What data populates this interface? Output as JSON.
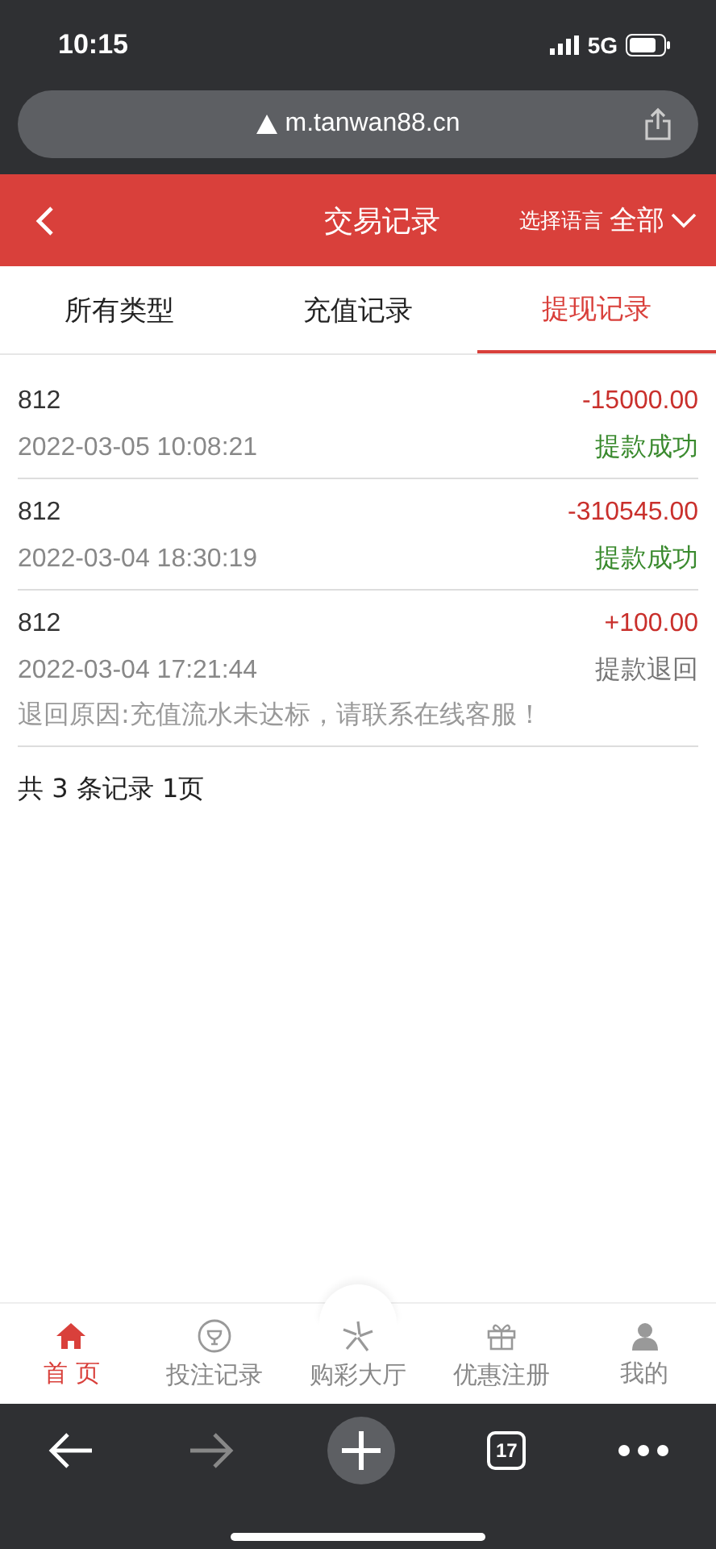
{
  "status_bar": {
    "time": "10:15",
    "network": "5G"
  },
  "browser": {
    "url": "m.tanwan88.cn",
    "tab_count": "17"
  },
  "header": {
    "title": "交易记录",
    "language": "选择语言",
    "filter": "全部"
  },
  "tabs": [
    {
      "label": "所有类型",
      "selected": false
    },
    {
      "label": "充值记录",
      "selected": false
    },
    {
      "label": "提现记录",
      "selected": true
    }
  ],
  "records": [
    {
      "name": "812",
      "amount": "-15000.00",
      "time": "2022-03-05 10:08:21",
      "status": "提款成功",
      "kind": "success"
    },
    {
      "name": "812",
      "amount": "-310545.00",
      "time": "2022-03-04 18:30:19",
      "status": "提款成功",
      "kind": "success"
    },
    {
      "name": "812",
      "amount": "+100.00",
      "time": "2022-03-04 17:21:44",
      "status": "提款退回",
      "kind": "returned",
      "note": "退回原因:充值流水未达标，请联系在线客服！"
    }
  ],
  "summary": "共 3 条记录 1页",
  "nav": [
    {
      "label": "首 页",
      "selected": true
    },
    {
      "label": "投注记录",
      "selected": false
    },
    {
      "label": "购彩大厅",
      "selected": false
    },
    {
      "label": "优惠注册",
      "selected": false
    },
    {
      "label": "我的",
      "selected": false
    }
  ]
}
